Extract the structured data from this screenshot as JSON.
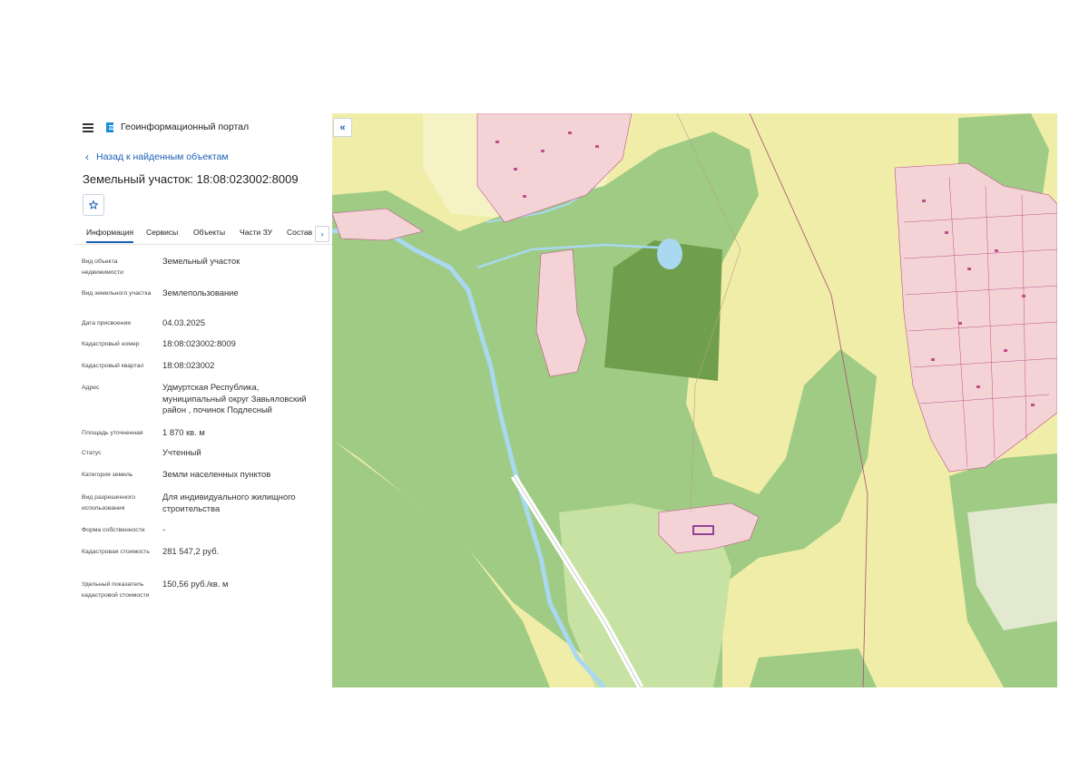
{
  "app": {
    "title": "Геоинформационный портал"
  },
  "nav": {
    "back_label": "Назад к найденным объектам"
  },
  "object": {
    "title": "Земельный участок: 18:08:023002:8009"
  },
  "tabs": [
    "Информация",
    "Сервисы",
    "Объекты",
    "Части ЗУ",
    "Состав"
  ],
  "fields": [
    {
      "label": "Вид объекта недвижимости",
      "value": "Земельный участок"
    },
    {
      "label": "Вид земельного участка",
      "value": "Землепользование"
    },
    {
      "label": "Дата присвоения",
      "value": "04.03.2025"
    },
    {
      "label": "Кадастровый номер",
      "value": "18:08:023002:8009"
    },
    {
      "label": "Кадастровый квартал",
      "value": "18:08:023002"
    },
    {
      "label": "Адрес",
      "value": "Удмуртская Республика, муниципальный округ Завьяловский район , починок Подлесный"
    },
    {
      "label": "Площадь уточненная",
      "value": "1 870 кв. м"
    },
    {
      "label": "Статус",
      "value": "Учтенный"
    },
    {
      "label": "Категория земель",
      "value": "Земли населенных пунктов"
    },
    {
      "label": "Вид разрешенного использования",
      "value": "Для индивидуального жилищного строительства"
    },
    {
      "label": "Форма собственности",
      "value": "-"
    },
    {
      "label": "Кадастровая стоимость",
      "value": "281 547,2 руб."
    },
    {
      "label": "Удельный показатель кадастровой стоимости",
      "value": "150,56 руб./кв. м"
    }
  ],
  "icons": {
    "menu": "menu-icon",
    "logo": "portal-logo-icon",
    "back": "chevron-left-icon",
    "favorite": "star-icon",
    "tabs_next": "chevron-right-icon",
    "collapse": "double-chevron-left-icon"
  },
  "colors": {
    "accent": "#1a5fb4",
    "forest": "#9fcb84",
    "field": "#f0eda8",
    "settlement": "#f4d3d6",
    "parcel_border": "#c0508a",
    "water": "#a9d8f0",
    "selected_parcel": "#6f9f4c"
  }
}
